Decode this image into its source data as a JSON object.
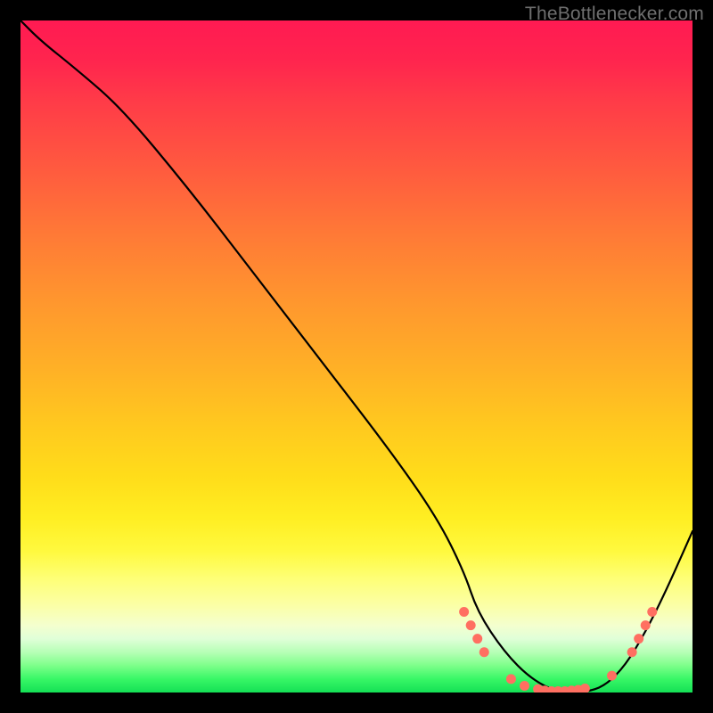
{
  "watermark": {
    "text": "TheBottlenecker.com"
  },
  "chart_data": {
    "type": "line",
    "title": "",
    "xlabel": "",
    "ylabel": "",
    "xlim": [
      0,
      100
    ],
    "ylim": [
      0,
      100
    ],
    "series": [
      {
        "name": "bottleneck-curve",
        "x": [
          0,
          3,
          8,
          15,
          25,
          35,
          45,
          55,
          62,
          66,
          68,
          72,
          76,
          80,
          84,
          87,
          90,
          93,
          96,
          100
        ],
        "y": [
          100,
          97,
          93,
          87,
          75,
          62,
          49,
          36,
          26,
          18,
          12,
          6,
          2,
          0,
          0,
          1,
          4,
          9,
          15,
          24
        ]
      }
    ],
    "markers": {
      "name": "highlight-dots",
      "color": "#ff6f61",
      "points": [
        {
          "x": 66,
          "y": 12
        },
        {
          "x": 67,
          "y": 10
        },
        {
          "x": 68,
          "y": 8
        },
        {
          "x": 69,
          "y": 6
        },
        {
          "x": 73,
          "y": 2
        },
        {
          "x": 75,
          "y": 1
        },
        {
          "x": 77,
          "y": 0.5
        },
        {
          "x": 78,
          "y": 0.3
        },
        {
          "x": 79,
          "y": 0.2
        },
        {
          "x": 80,
          "y": 0.2
        },
        {
          "x": 81,
          "y": 0.2
        },
        {
          "x": 82,
          "y": 0.3
        },
        {
          "x": 83,
          "y": 0.4
        },
        {
          "x": 84,
          "y": 0.6
        },
        {
          "x": 88,
          "y": 2.5
        },
        {
          "x": 91,
          "y": 6
        },
        {
          "x": 92,
          "y": 8
        },
        {
          "x": 93,
          "y": 10
        },
        {
          "x": 94,
          "y": 12
        }
      ]
    },
    "background": {
      "type": "vertical-gradient",
      "stops": [
        {
          "pos": 0,
          "color": "#ff1a52"
        },
        {
          "pos": 50,
          "color": "#ffb126"
        },
        {
          "pos": 80,
          "color": "#fff93f"
        },
        {
          "pos": 100,
          "color": "#14e055"
        }
      ]
    }
  }
}
